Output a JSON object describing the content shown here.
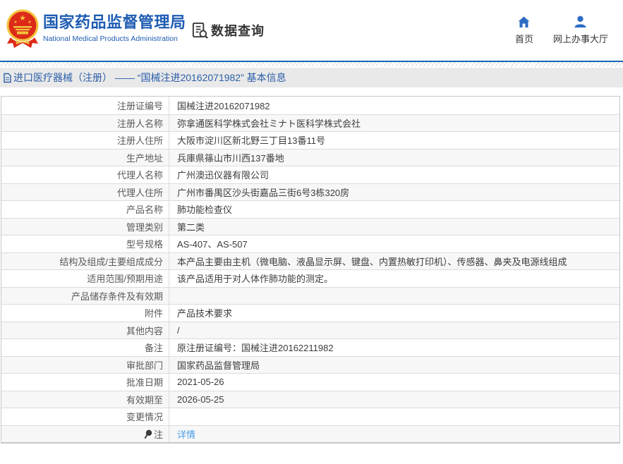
{
  "header": {
    "org_name_zh": "国家药品监督管理局",
    "org_name_en": "National Medical Products Administration",
    "nav_search_label": "数据查询",
    "nav_home_label": "首页",
    "nav_hall_label": "网上办事大厅"
  },
  "breadcrumb": {
    "text": "进口医疗器械（注册） —— “国械注进20162071982” 基本信息"
  },
  "table": {
    "rows": [
      {
        "label": "注册证编号",
        "value": "国械注进20162071982"
      },
      {
        "label": "注册人名称",
        "value": "弥拿通医科学株式会社ミナト医科学株式会社"
      },
      {
        "label": "注册人住所",
        "value": "大阪市淀川区新北野三丁目13番11号"
      },
      {
        "label": "生产地址",
        "value": "兵庫県篠山市川西137番地"
      },
      {
        "label": "代理人名称",
        "value": "广州澳迅仪器有限公司"
      },
      {
        "label": "代理人住所",
        "value": "广州市番禺区沙头街嘉品三街6号3栋320房"
      },
      {
        "label": "产品名称",
        "value": "肺功能检查仪"
      },
      {
        "label": "管理类别",
        "value": "第二类"
      },
      {
        "label": "型号规格",
        "value": "AS-407、AS-507"
      },
      {
        "label": "结构及组成/主要组成成分",
        "value": "本产品主要由主机（微电脑、液晶显示屏、键盘、内置热敏打印机）、传感器、鼻夹及电源线组成"
      },
      {
        "label": "适用范围/预期用途",
        "value": "该产品适用于对人体作肺功能的测定。"
      },
      {
        "label": "产品储存条件及有效期",
        "value": ""
      },
      {
        "label": "附件",
        "value": "产品技术要求"
      },
      {
        "label": "其他内容",
        "value": "/"
      },
      {
        "label": "备注",
        "value": "原注册证编号：国械注进20162211982"
      },
      {
        "label": "审批部门",
        "value": "国家药品监督管理局"
      },
      {
        "label": "批准日期",
        "value": "2021-05-26"
      },
      {
        "label": "有效期至",
        "value": "2026-05-25"
      },
      {
        "label": "变更情况",
        "value": ""
      },
      {
        "label": "注",
        "value": "详情"
      }
    ]
  },
  "icons": {
    "emblem": "china-national-emblem",
    "search": "document-search-icon",
    "home": "home-icon",
    "hall": "user-icon",
    "breadcrumb": "document-icon",
    "note": "pin-icon"
  },
  "colors": {
    "brand_blue": "#1e5cb3",
    "icon_blue": "#2e6cc4",
    "link_blue": "#4a9ee8",
    "breadcrumb_bg": "#e9e9e9",
    "stripe_gray": "#f7f7f7",
    "border_gray": "#dcdcdc"
  }
}
